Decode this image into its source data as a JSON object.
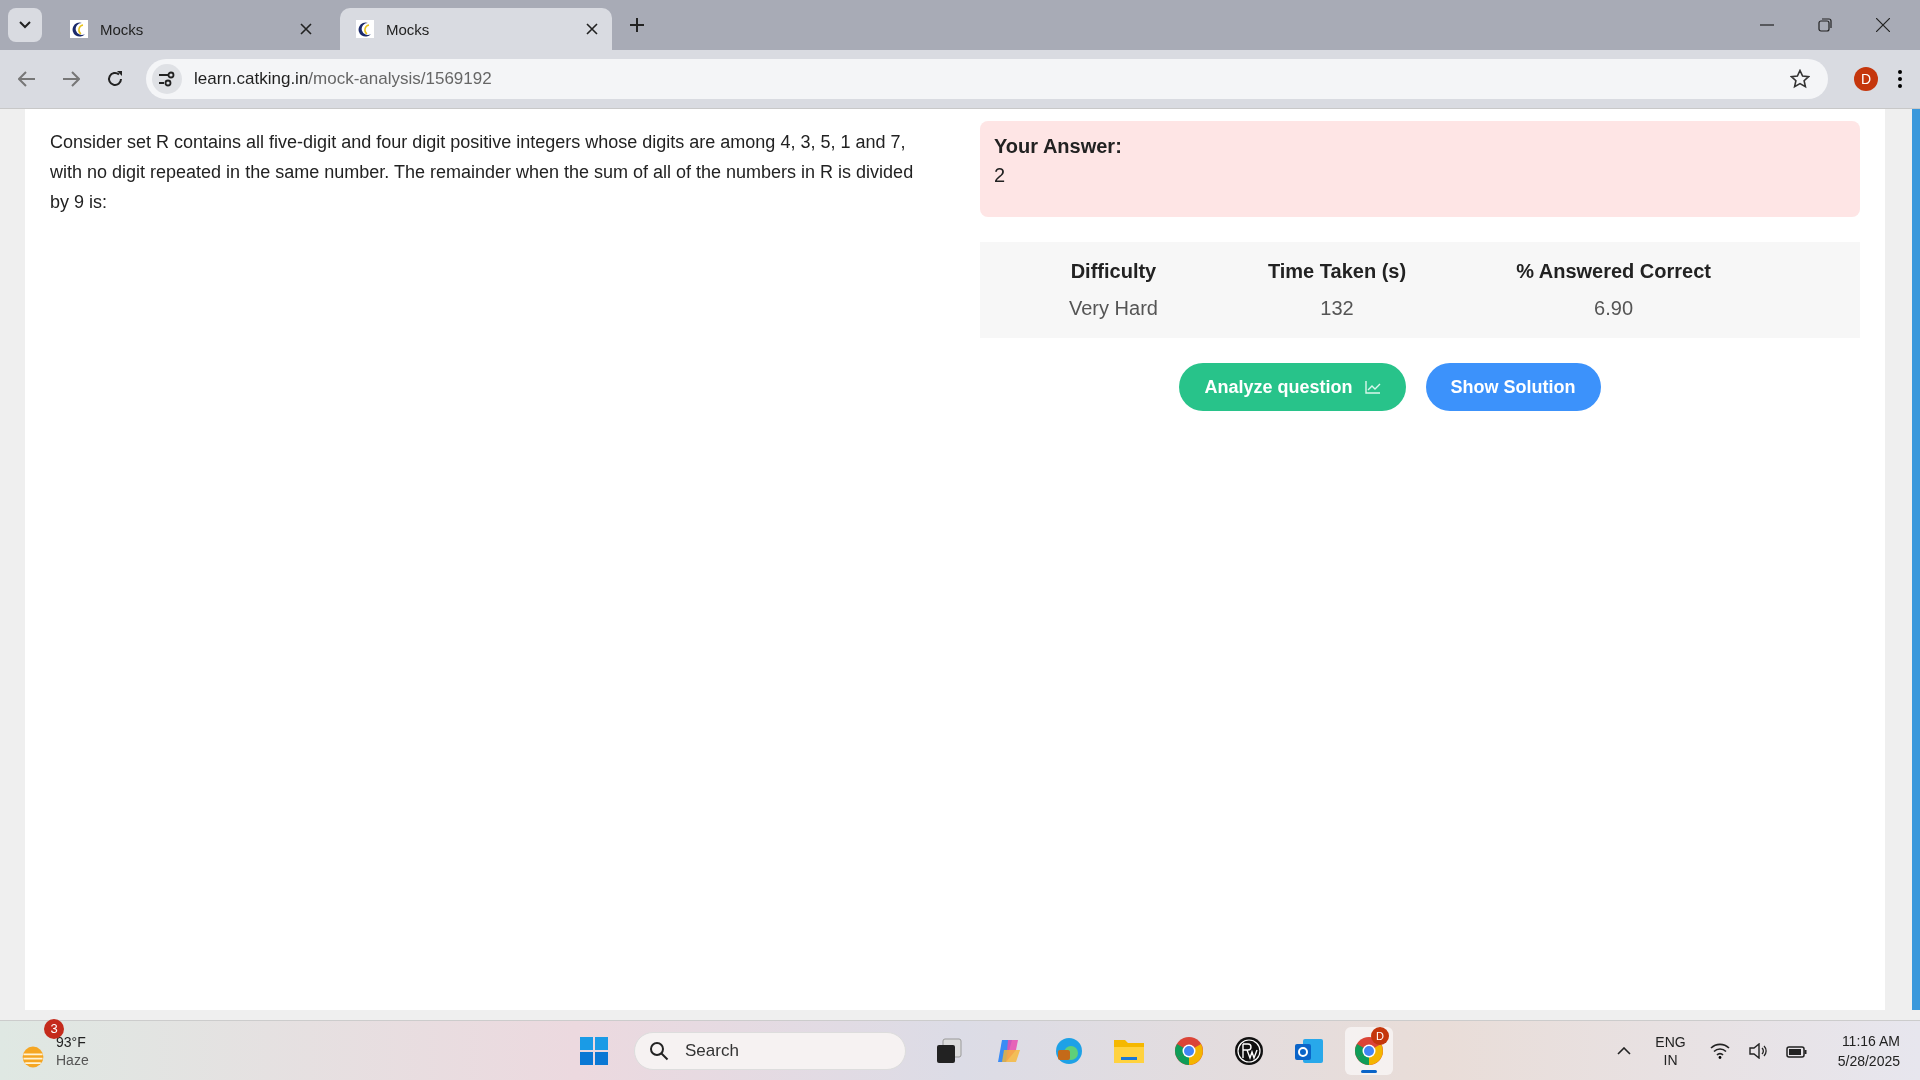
{
  "browser": {
    "tabs": [
      {
        "title": "Mocks",
        "selected": false
      },
      {
        "title": "Mocks",
        "selected": true
      }
    ],
    "address": {
      "domain": "learn.catking.in",
      "path": "/mock-analysis/1569192"
    },
    "profile_initial": "D"
  },
  "question": {
    "text": "Consider set R contains all five-digit and four digit positive integers whose digits are among 4, 3, 5, 1 and 7, with no digit repeated in the same number. The remainder when the sum of all of the numbers in R is divided by 9 is:"
  },
  "your_answer": {
    "label": "Your Answer:",
    "value": "2"
  },
  "stats": {
    "columns": [
      {
        "heading": "Difficulty",
        "value": "Very Hard"
      },
      {
        "heading": "Time Taken (s)",
        "value": "132"
      },
      {
        "heading": "% Answered Correct",
        "value": "6.90"
      }
    ]
  },
  "buttons": [
    {
      "kind": "analyze",
      "label": "Analyze question"
    },
    {
      "kind": "solution",
      "label": "Show Solution"
    }
  ],
  "taskbar": {
    "weather": {
      "badge": "3",
      "temperature": "93°F",
      "condition": "Haze"
    },
    "search_placeholder": "Search",
    "apps": [
      {
        "kind": "taskview",
        "active": false
      },
      {
        "kind": "copilot",
        "active": false
      },
      {
        "kind": "edge",
        "active": false
      },
      {
        "kind": "folder",
        "active": false
      },
      {
        "kind": "chrome",
        "active": false
      },
      {
        "kind": "pw",
        "active": false
      },
      {
        "kind": "outlook",
        "active": false
      },
      {
        "kind": "chrome-profile",
        "active": true,
        "badge": "D"
      }
    ],
    "language": [
      "ENG",
      "IN"
    ],
    "time": "11:16 AM",
    "date": "5/28/2025"
  }
}
